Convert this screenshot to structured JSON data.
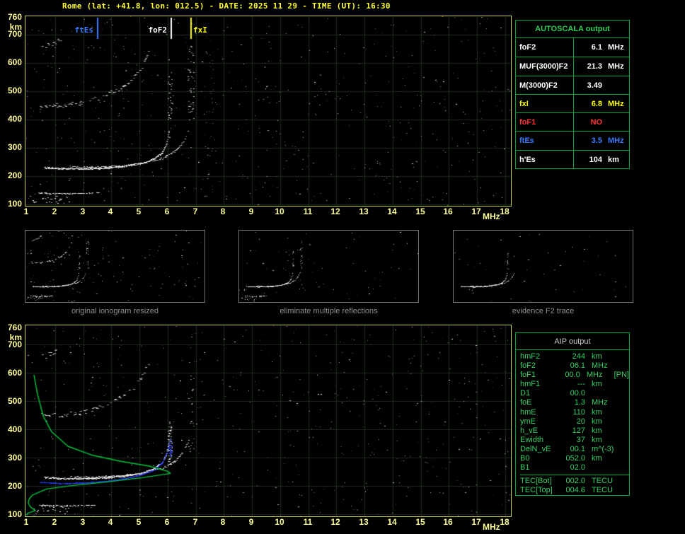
{
  "title": "Rome (lat: +41.8, lon: 012.5) - DATE: 2025 11 29 - TIME (UT): 16:30",
  "colors": {
    "background": "#000000",
    "title": "#ffff33",
    "axis_text": "#ffff99",
    "plot_border": "#c8c84a",
    "grid": "#1c2e1c",
    "echo": "#ffffff",
    "table_border": "#00a43c",
    "table_header_text": "#2fcc55",
    "aip_text": "#35d065",
    "aip_header_text": "#cccccc",
    "caption": "#909090",
    "thumb_border": "#787878",
    "ftEs_blue": "#3b7bff",
    "restored_trace_blue": "#2a3bff",
    "fxI_yellow": "#ffff00",
    "foF2_white": "#ffffff",
    "foF1_red": "#ff3333",
    "profile_green": "#00c840"
  },
  "axes": {
    "x_label": "MHz",
    "y_label": "km",
    "x_ticks": [
      1,
      2,
      3,
      4,
      5,
      6,
      7,
      8,
      9,
      10,
      11,
      12,
      13,
      14,
      15,
      16,
      17,
      18
    ],
    "y_ticks": [
      100,
      200,
      300,
      400,
      500,
      600,
      700,
      760
    ]
  },
  "autoscala": {
    "header": "AUTOSCALA output",
    "rows": [
      {
        "param": "foF2",
        "value": "6.1",
        "unit": "MHz",
        "color": "#ffffff"
      },
      {
        "param": "MUF(3000)F2",
        "value": "21.3",
        "unit": "MHz",
        "color": "#ffffff"
      },
      {
        "param": "M(3000)F2",
        "value": "3.49",
        "unit": "",
        "color": "#ffffff"
      },
      {
        "param": "fxI",
        "value": "6.8",
        "unit": "MHz",
        "color": "#ffff00"
      },
      {
        "param": "foF1",
        "value": "NO",
        "unit": "",
        "color": "#ff3333"
      },
      {
        "param": "ftEs",
        "value": "3.5",
        "unit": "MHz",
        "color": "#3b7bff"
      },
      {
        "param": "h'Es",
        "value": "104",
        "unit": "km",
        "color": "#ffffff"
      }
    ]
  },
  "thumbnails": [
    {
      "caption": "original ionogram resized"
    },
    {
      "caption": "eliminate multiple reflections"
    },
    {
      "caption": "evidence F2 trace"
    }
  ],
  "aip": {
    "header": "AIP output",
    "rows": [
      {
        "param": "hmF2",
        "value": "244",
        "unit": "km",
        "note": ""
      },
      {
        "param": "foF2",
        "value": "06.1",
        "unit": "MHz",
        "note": ""
      },
      {
        "param": "foF1",
        "value": "00.0",
        "unit": "MHz",
        "note": "[PN]"
      },
      {
        "param": "hmF1",
        "value": "---",
        "unit": "km",
        "note": ""
      },
      {
        "param": "D1",
        "value": "00.0",
        "unit": "",
        "note": ""
      },
      {
        "param": "foE",
        "value": "1.3",
        "unit": "MHz",
        "note": ""
      },
      {
        "param": "hmE",
        "value": "110",
        "unit": "km",
        "note": ""
      },
      {
        "param": "ymE",
        "value": "20",
        "unit": "km",
        "note": ""
      },
      {
        "param": "h_vE",
        "value": "127",
        "unit": "km",
        "note": ""
      },
      {
        "param": "Ewidth",
        "value": "37",
        "unit": "km",
        "note": ""
      },
      {
        "param": "DelN_vE",
        "value": "00.1",
        "unit": "m^(-3)",
        "note": ""
      },
      {
        "param": "B0",
        "value": "052.0",
        "unit": "km",
        "note": ""
      },
      {
        "param": "B1",
        "value": "02.0",
        "unit": "",
        "note": ""
      }
    ],
    "tec_rows": [
      {
        "param": "TEC[Bot]",
        "value": "002.0",
        "unit": "TECU",
        "note": ""
      },
      {
        "param": "TEC[Top]",
        "value": "004.6",
        "unit": "TECU",
        "note": ""
      }
    ]
  },
  "chart_data": [
    {
      "id": "top_ionogram",
      "type": "scatter",
      "title": "Ionogram with AUTOSCALA markers",
      "xlabel": "MHz",
      "ylabel": "km",
      "xlim": [
        1,
        18
      ],
      "ylim": [
        100,
        760
      ],
      "grid": true,
      "noise_count": 560,
      "series": [
        {
          "id": "es",
          "name": "Es layer trace",
          "color": "#ffffff",
          "size": 2,
          "gap": 0.42,
          "jitter": 1.5,
          "step": 0.02,
          "points": [
            [
              1.4,
              141
            ],
            [
              2.0,
              139
            ],
            [
              2.7,
              139
            ],
            [
              3.3,
              141
            ],
            [
              3.55,
              143
            ]
          ]
        },
        {
          "id": "clutter",
          "name": "near-range clutter",
          "color": "#ffffff",
          "size": 2,
          "gap": 0.55,
          "jitter": 14,
          "step": 0.03,
          "points": [
            [
              1.1,
              120
            ],
            [
              1.9,
              118
            ],
            [
              2.5,
              117
            ]
          ]
        },
        {
          "id": "f2o",
          "name": "F2 ordinary trace",
          "color": "#ffffff",
          "size": 2,
          "gap": 0.05,
          "jitter": 2.5,
          "step": 0.015,
          "points": [
            [
              1.6,
              231
            ],
            [
              2.2,
              227
            ],
            [
              3.0,
              226
            ],
            [
              3.8,
              229
            ],
            [
              4.5,
              236
            ],
            [
              5.1,
              247
            ],
            [
              5.5,
              261
            ],
            [
              5.8,
              284
            ],
            [
              5.95,
              315
            ],
            [
              6.05,
              368
            ]
          ]
        },
        {
          "id": "f2x",
          "name": "F2 extraordinary trace",
          "color": "#e8e8e8",
          "size": 2,
          "gap": 0.3,
          "jitter": 2.5,
          "step": 0.02,
          "points": [
            [
              2.5,
              234
            ],
            [
              3.4,
              232
            ],
            [
              4.3,
              237
            ],
            [
              5.1,
              247
            ],
            [
              5.8,
              263
            ],
            [
              6.25,
              289
            ],
            [
              6.55,
              323
            ],
            [
              6.75,
              365
            ]
          ]
        },
        {
          "id": "hop2",
          "name": "second-hop F echo",
          "color": "#d8d8d8",
          "size": 3,
          "gap": 0.55,
          "jitter": 7,
          "step": 0.03,
          "points": [
            [
              1.45,
              452
            ],
            [
              2.2,
              450
            ],
            [
              3.0,
              462
            ],
            [
              3.7,
              483
            ],
            [
              4.3,
              512
            ],
            [
              4.8,
              550
            ],
            [
              5.1,
              592
            ],
            [
              5.3,
              638
            ]
          ]
        },
        {
          "id": "hop3",
          "name": "third-hop fragment",
          "color": "#c8c8c8",
          "size": 3,
          "gap": 0.6,
          "jitter": 8,
          "step": 0.035,
          "points": [
            [
              1.45,
              655
            ],
            [
              1.9,
              668
            ],
            [
              2.4,
              700
            ]
          ]
        },
        {
          "id": "cusp_o",
          "name": "o-mode cusp spread",
          "vertical": true,
          "f": 6.07,
          "f_spread": 0.08,
          "h_range": [
            390,
            560
          ],
          "count": 28,
          "color": "#e0e0e0",
          "size": 2
        },
        {
          "id": "cusp_x",
          "name": "x-mode cusp spread",
          "vertical": true,
          "f": 6.82,
          "f_spread": 0.12,
          "h_range": [
            390,
            660
          ],
          "count": 42,
          "color": "#e0e0e0",
          "size": 2
        },
        {
          "id": "rfi1",
          "name": "interference column",
          "vertical": true,
          "f": 7.55,
          "f_spread": 0.1,
          "h_range": [
            130,
            700
          ],
          "count": 24,
          "color": "#909090",
          "size": 1
        }
      ],
      "markers": [
        {
          "label": "ftEs",
          "freq": 3.5,
          "color": "#3b7bff",
          "align": "left"
        },
        {
          "label": "foF2",
          "freq": 6.1,
          "color": "#ffffff",
          "align": "left"
        },
        {
          "label": "fxI",
          "freq": 6.8,
          "color": "#ffff00",
          "align": "right"
        }
      ]
    },
    {
      "id": "bottom_ionogram",
      "type": "scatter",
      "title": "Ionogram with restored trace and electron density profile",
      "xlabel": "MHz",
      "ylabel": "km",
      "xlim": [
        1,
        18
      ],
      "ylim": [
        100,
        760
      ],
      "grid": true,
      "noise_count": 500,
      "series": [
        {
          "id": "es",
          "name": "Es layer trace",
          "color": "#ffffff",
          "size": 2,
          "gap": 0.42,
          "jitter": 1.5,
          "step": 0.02,
          "points": [
            [
              1.4,
              133
            ],
            [
              2.0,
              131
            ],
            [
              2.7,
              131
            ],
            [
              3.4,
              133
            ]
          ]
        },
        {
          "id": "clutter",
          "name": "near-range clutter",
          "color": "#ffffff",
          "size": 2,
          "gap": 0.55,
          "jitter": 12,
          "step": 0.03,
          "points": [
            [
              1.1,
              118
            ],
            [
              1.9,
              116
            ],
            [
              2.5,
              115
            ]
          ]
        },
        {
          "id": "f2o",
          "name": "F2 ordinary trace",
          "color": "#ffffff",
          "size": 2,
          "gap": 0.05,
          "jitter": 2.5,
          "step": 0.015,
          "points": [
            [
              1.6,
              231
            ],
            [
              2.2,
              227
            ],
            [
              3.0,
              226
            ],
            [
              3.8,
              229
            ],
            [
              4.5,
              236
            ],
            [
              5.1,
              247
            ],
            [
              5.5,
              261
            ],
            [
              5.8,
              284
            ],
            [
              5.95,
              315
            ],
            [
              6.05,
              368
            ]
          ]
        },
        {
          "id": "f2x",
          "name": "F2 extraordinary trace",
          "color": "#e8e8e8",
          "size": 2,
          "gap": 0.32,
          "jitter": 2.5,
          "step": 0.02,
          "points": [
            [
              2.5,
              234
            ],
            [
              3.4,
              232
            ],
            [
              4.3,
              237
            ],
            [
              5.1,
              247
            ],
            [
              5.8,
              263
            ],
            [
              6.25,
              289
            ],
            [
              6.55,
              323
            ],
            [
              6.75,
              365
            ]
          ]
        },
        {
          "id": "hop2",
          "name": "second-hop F echo",
          "color": "#d8d8d8",
          "size": 3,
          "gap": 0.58,
          "jitter": 7,
          "step": 0.03,
          "points": [
            [
              1.45,
              452
            ],
            [
              2.2,
              450
            ],
            [
              3.0,
              462
            ],
            [
              3.7,
              483
            ],
            [
              4.3,
              512
            ],
            [
              4.8,
              550
            ],
            [
              5.1,
              592
            ],
            [
              5.3,
              638
            ]
          ]
        },
        {
          "id": "hop3",
          "name": "third-hop fragment",
          "color": "#c8c8c8",
          "size": 3,
          "gap": 0.62,
          "jitter": 8,
          "step": 0.035,
          "points": [
            [
              1.45,
              655
            ],
            [
              1.9,
              668
            ],
            [
              2.4,
              700
            ]
          ]
        },
        {
          "id": "cusp_o",
          "name": "o-mode cusp spread",
          "vertical": true,
          "f": 6.07,
          "f_spread": 0.06,
          "h_range": [
            275,
            430
          ],
          "count": 60,
          "color": "#ffffff",
          "size": 2
        },
        {
          "id": "cusp_x",
          "name": "x-mode cusp spread",
          "vertical": true,
          "f": 6.82,
          "f_spread": 0.1,
          "h_range": [
            320,
            600
          ],
          "count": 22,
          "color": "#cfcfcf",
          "size": 2
        },
        {
          "id": "restored",
          "name": "AUTOSCALA restored trace",
          "color": "#2a3bff",
          "size": 2,
          "gap": 0.04,
          "jitter": 1.2,
          "step": 0.012,
          "points": [
            [
              1.45,
              214
            ],
            [
              2.2,
              209
            ],
            [
              3.0,
              211
            ],
            [
              3.8,
              217
            ],
            [
              4.5,
              227
            ],
            [
              5.1,
              241
            ],
            [
              5.55,
              259
            ],
            [
              5.82,
              286
            ],
            [
              5.97,
              320
            ],
            [
              6.07,
              362
            ]
          ]
        },
        {
          "id": "restored_cusp",
          "name": "restored trace cusp",
          "vertical": true,
          "f": 6.09,
          "f_spread": 0.05,
          "h_range": [
            300,
            368
          ],
          "count": 30,
          "color": "#2a3bff",
          "size": 2
        },
        {
          "id": "profile",
          "name": "electron density profile N(h)",
          "kind": "line",
          "color": "#00c840",
          "points": [
            [
              0.97,
              97
            ],
            [
              1.05,
              104
            ],
            [
              1.3,
              113
            ],
            [
              1.12,
              126
            ],
            [
              1.05,
              140
            ],
            [
              1.08,
              153
            ],
            [
              1.2,
              168
            ],
            [
              1.7,
              189
            ],
            [
              2.58,
              201
            ],
            [
              3.84,
              214
            ],
            [
              5.1,
              229
            ],
            [
              6.1,
              244
            ],
            [
              5.98,
              252
            ],
            [
              5.35,
              270
            ],
            [
              4.34,
              287
            ],
            [
              3.34,
              308
            ],
            [
              2.46,
              340
            ],
            [
              1.88,
              391
            ],
            [
              1.58,
              447
            ],
            [
              1.38,
              523
            ],
            [
              1.25,
              593
            ]
          ]
        }
      ],
      "markers": []
    }
  ],
  "render": {
    "seed": 20251129,
    "thumbs": [
      {
        "include": [
          "es",
          "clutter",
          "f2o",
          "f2x",
          "hop2",
          "hop3",
          "cusp_o",
          "cusp_x"
        ],
        "noise": 120
      },
      {
        "include": [
          "es",
          "clutter",
          "f2o",
          "f2x",
          "cusp_o",
          "cusp_x"
        ],
        "noise": 70
      },
      {
        "include": [
          "f2o",
          "f2x",
          "cusp_o"
        ],
        "noise": 45
      }
    ]
  }
}
